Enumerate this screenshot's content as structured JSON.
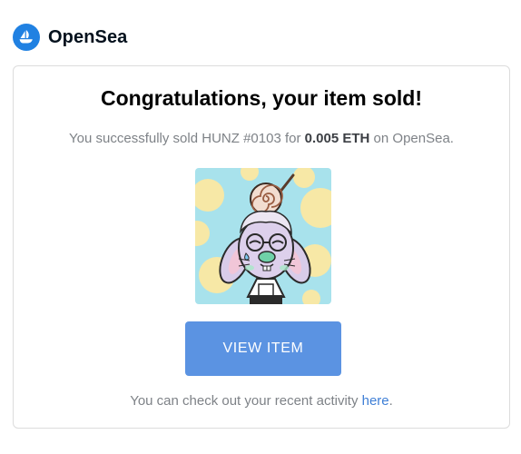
{
  "brand": {
    "name": "OpenSea",
    "color": "#2081e2",
    "logo_icon": "opensea-sailboat-icon"
  },
  "email": {
    "headline": "Congratulations, your item sold!",
    "sold_prefix": "You successfully sold",
    "item_name": "HUNZ #0103",
    "price_prefix": "for",
    "price": "0.005 ETH",
    "marketplace_suffix": "on OpenSea.",
    "nft_image": "cartoon-rabbit-with-lollipop-image",
    "button_label": "VIEW ITEM",
    "button_color": "#5b93e2",
    "footer_prefix": "You can check out your recent activity",
    "footer_link": "here",
    "footer_suffix": "."
  }
}
